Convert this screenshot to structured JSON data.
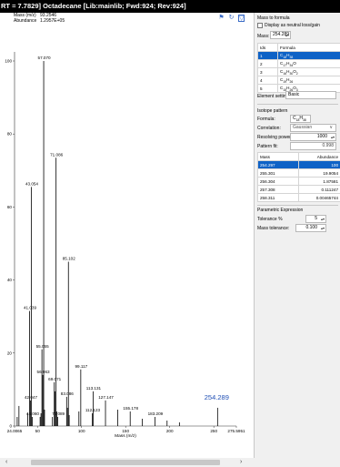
{
  "window": {
    "title": "RT = 7.7829] Octadecane [Lib:mainlib; Fwd:924; Rev:924]"
  },
  "readout": {
    "mass_label": "Mass (m/z)",
    "mass_value": "93.2546",
    "abundance_label": "Abundance",
    "abundance_value": "1.2957E+05"
  },
  "chart_data": {
    "type": "bar",
    "xlabel": "Mass (m/z)",
    "ylabel": "",
    "xlim": [
      24.0065,
      275.5951
    ],
    "ylim": [
      0,
      100
    ],
    "x_ticks": [
      "24.0065",
      "50",
      "100",
      "150",
      "200",
      "250",
      "275.5951"
    ],
    "y_ticks": [
      "0",
      "20",
      "40",
      "60",
      "80",
      "100"
    ],
    "peaks": [
      {
        "x": 27,
        "y": 2.5,
        "label": ""
      },
      {
        "x": 29,
        "y": 5.5,
        "label": ""
      },
      {
        "x": 39,
        "y": 3.5,
        "label": ""
      },
      {
        "x": 41.039,
        "y": 31.5,
        "label": "41.039"
      },
      {
        "x": 42.047,
        "y": 7.0,
        "label": "42.047"
      },
      {
        "x": 43.054,
        "y": 65.5,
        "label": "43.054"
      },
      {
        "x": 44.06,
        "y": 2.5,
        "label": "44.060"
      },
      {
        "x": 53,
        "y": 2.5,
        "label": ""
      },
      {
        "x": 54,
        "y": 3.5,
        "label": ""
      },
      {
        "x": 55.055,
        "y": 21.0,
        "label": "55.055"
      },
      {
        "x": 56.063,
        "y": 14.0,
        "label": "56.063"
      },
      {
        "x": 57.07,
        "y": 100,
        "label": "57.070"
      },
      {
        "x": 58,
        "y": 4.5,
        "label": ""
      },
      {
        "x": 67,
        "y": 2.5,
        "label": ""
      },
      {
        "x": 69.071,
        "y": 12.0,
        "label": "69.071"
      },
      {
        "x": 70,
        "y": 9.5,
        "label": ""
      },
      {
        "x": 71.086,
        "y": 73.5,
        "label": "71.086"
      },
      {
        "x": 72,
        "y": 4.0,
        "label": ""
      },
      {
        "x": 73.089,
        "y": 2.5,
        "label": "73.089"
      },
      {
        "x": 83.086,
        "y": 8.0,
        "label": "83.086"
      },
      {
        "x": 84,
        "y": 5.0,
        "label": ""
      },
      {
        "x": 85.102,
        "y": 45.0,
        "label": "85.102"
      },
      {
        "x": 86,
        "y": 3.0,
        "label": ""
      },
      {
        "x": 97,
        "y": 4.0,
        "label": ""
      },
      {
        "x": 99.117,
        "y": 15.5,
        "label": "99.117"
      },
      {
        "x": 112.123,
        "y": 3.5,
        "label": "112.123"
      },
      {
        "x": 113.131,
        "y": 9.5,
        "label": "113.131"
      },
      {
        "x": 127.147,
        "y": 7.0,
        "label": "127.147"
      },
      {
        "x": 141,
        "y": 4.5,
        "label": ""
      },
      {
        "x": 155.178,
        "y": 4.0,
        "label": "155.178"
      },
      {
        "x": 169,
        "y": 2.0,
        "label": ""
      },
      {
        "x": 183.209,
        "y": 2.5,
        "label": "183.209"
      },
      {
        "x": 197,
        "y": 1.5,
        "label": ""
      },
      {
        "x": 211,
        "y": 1.0,
        "label": ""
      },
      {
        "x": 254.289,
        "y": 5.0,
        "label": "254.289"
      }
    ],
    "highlight_label": "254.289",
    "highlight_color": "#1f4fb5"
  },
  "mass_to_formula": {
    "section": "Mass to formula",
    "neutral_label": "Display as neutral loss/gain",
    "mass_label": "Mass:",
    "mass_value": "254.289",
    "columns": [
      "Ids",
      "Formula"
    ],
    "rows": [
      {
        "id": "1",
        "parts": [
          [
            "C",
            "18"
          ],
          [
            "H",
            "38"
          ]
        ]
      },
      {
        "id": "2",
        "parts": [
          [
            "C",
            "17"
          ],
          [
            "H",
            "34"
          ],
          [
            "O",
            ""
          ]
        ]
      },
      {
        "id": "3",
        "parts": [
          [
            "C",
            "16"
          ],
          [
            "H",
            "30"
          ],
          [
            "O",
            "2"
          ]
        ]
      },
      {
        "id": "4",
        "parts": [
          [
            "C",
            "19"
          ],
          [
            "H",
            "26"
          ]
        ]
      },
      {
        "id": "5",
        "parts": [
          [
            "C",
            "15"
          ],
          [
            "H",
            "26"
          ],
          [
            "O",
            "3"
          ]
        ]
      }
    ]
  },
  "element_settings": {
    "label": "Element settings:",
    "value": "Basic"
  },
  "isotope": {
    "section": "Isotope pattern",
    "formula_label": "Formula:",
    "formula_parts": [
      [
        "C",
        "18"
      ],
      [
        "H",
        "38"
      ]
    ],
    "correlation_label": "Correlation:",
    "correlation_value": "Gaussian",
    "resolving_label": "Resolving power:",
    "resolving_value": "1000",
    "fit_label": "Pattern fit:",
    "fit_value": "0.998",
    "columns": [
      "Mass",
      "Abundance"
    ],
    "rows": [
      [
        "254.297",
        "100"
      ],
      [
        "255.301",
        "19.9054"
      ],
      [
        "256.304",
        "1.87581"
      ],
      [
        "257.308",
        "0.111247"
      ],
      [
        "258.311",
        "0.00465744"
      ]
    ]
  },
  "parametric": {
    "section": "Parametric Expression",
    "tolerance_label": "Tolerance %",
    "tolerance_value": "5",
    "mass_tol_label": "Mass tolerance:",
    "mass_tol_value": "0.100"
  },
  "colors": {
    "selection": "#0e62c6",
    "spectrum": "#000000",
    "highlight": "#1f4fb5"
  },
  "icons": [
    "lock-icon",
    "link-icon",
    "pointer-icon",
    "dropdown-icon",
    "spin-icon",
    "scroll-left-icon",
    "scroll-right-icon"
  ]
}
